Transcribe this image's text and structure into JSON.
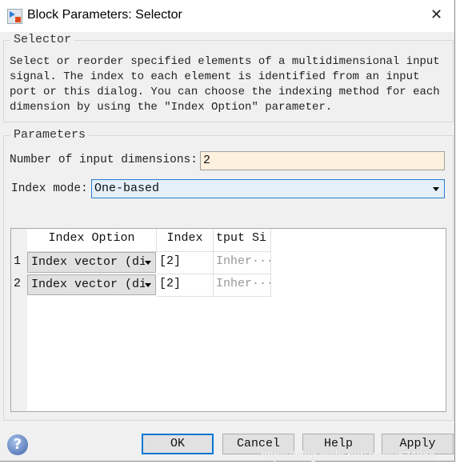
{
  "window": {
    "title": "Block Parameters: Selector",
    "close_icon": "close-icon"
  },
  "selector_group": {
    "legend": "Selector",
    "description": "Select or reorder specified elements of a multidimensional input signal. The index to each element is identified from an input port or this dialog. You can choose the indexing method for each dimension by using the \"Index Option\" parameter."
  },
  "parameters": {
    "legend": "Parameters",
    "num_dims_label": "Number of input dimensions:",
    "num_dims_value": "2",
    "index_mode_label": "Index mode:",
    "index_mode_value": "One-based"
  },
  "table": {
    "headers": [
      "Index Option",
      "Index",
      "tput Si"
    ],
    "rows": [
      {
        "num": "1",
        "option": "Index vector (di",
        "index": "[2]",
        "output": "Inher···"
      },
      {
        "num": "2",
        "option": "Index vector (di",
        "index": "[2]",
        "output": "Inher···"
      }
    ]
  },
  "buttons": {
    "ok": "OK",
    "cancel": "Cancel",
    "help": "Help",
    "apply": "Apply"
  },
  "watermark": "https://blog.csdn.net/zouxu634866"
}
